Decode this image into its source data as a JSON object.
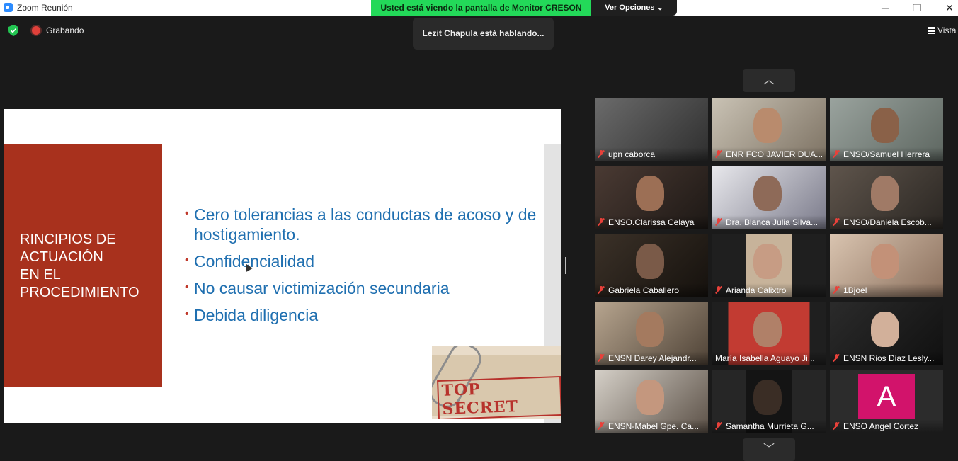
{
  "window": {
    "title": "Zoom Reunión",
    "minimize": "─",
    "restore": "❐",
    "close": "✕"
  },
  "share": {
    "banner": "Usted está viendo la pantalla de Monitor CRESON",
    "view_options": "Ver Opciones ⌄"
  },
  "status": {
    "recording": "Grabando",
    "speaking": "Lezit Chapula está hablando...",
    "view": "Vista"
  },
  "slide": {
    "title": "RINCIPIOS DE\nACTUACIÓN\nEN EL\nPROCEDIMIENTO",
    "bullets": [
      "Cero tolerancias a las conductas de acoso y de hostigamiento.",
      "Confidencialidad",
      "No causar victimización secundaria",
      "Debida diligencia"
    ],
    "stamp": "TOP SECRET",
    "colors": {
      "panel": "#a8311d",
      "bullet_text": "#1f6fb0"
    }
  },
  "nav": {
    "up": "︿",
    "down": "﹀"
  },
  "participants": [
    {
      "name": "upn caborca",
      "muted": true
    },
    {
      "name": "ENR FCO JAVIER DUA...",
      "muted": true
    },
    {
      "name": "ENSO/Samuel Herrera",
      "muted": true
    },
    {
      "name": "ENSO.Clarissa Celaya",
      "muted": true
    },
    {
      "name": "Dra. Blanca Julia Silva...",
      "muted": true
    },
    {
      "name": "ENSO/Daniela Escob...",
      "muted": true
    },
    {
      "name": "Gabriela Caballero",
      "muted": true
    },
    {
      "name": "Arianda Calixtro",
      "muted": true
    },
    {
      "name": "1Bjoel",
      "muted": true
    },
    {
      "name": "ENSN Darey Alejandr...",
      "muted": true
    },
    {
      "name": "María Isabella Aguayo Ji...",
      "muted": false
    },
    {
      "name": "ENSN Rios Diaz Lesly...",
      "muted": true
    },
    {
      "name": "ENSN-Mabel Gpe. Ca...",
      "muted": true
    },
    {
      "name": "Samantha Murrieta G...",
      "muted": true
    },
    {
      "name": "ENSO Angel Cortez",
      "muted": true,
      "avatar": "A"
    }
  ]
}
